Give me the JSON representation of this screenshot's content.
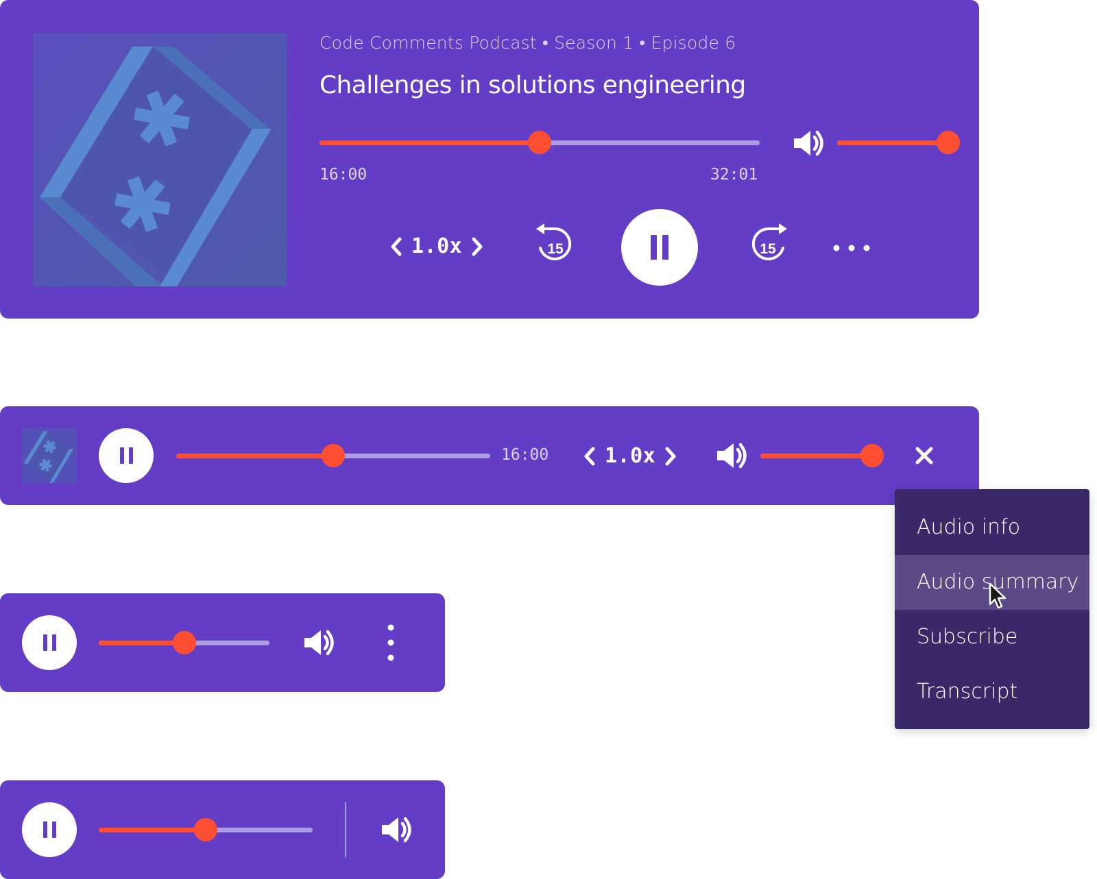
{
  "full_player": {
    "meta_line": "Code Comments Podcast • Season 1 • Episode 6",
    "title": "Challenges in solutions engineering",
    "progress_fraction": 0.5,
    "volume_fraction": 1.0,
    "elapsed": "16:00",
    "duration": "32:01",
    "speed": "1.0x",
    "rewind_seconds": "15",
    "forward_seconds": "15"
  },
  "compact_player": {
    "progress_fraction": 0.5,
    "volume_fraction": 1.0,
    "elapsed": "16:00",
    "speed": "1.0x"
  },
  "mini_player": {
    "progress_fraction": 0.5
  },
  "mini_player_2": {
    "progress_fraction": 0.5
  },
  "menu": {
    "items": [
      "Audio info",
      "Audio summary",
      "Subscribe",
      "Transcript"
    ],
    "hovered_index": 1
  },
  "colors": {
    "player_bg": "#633dc5",
    "accent": "#ff4f32",
    "track": "#a99de4",
    "menu_bg": "#3b2869",
    "menu_hover": "#5b4a86"
  },
  "icons": [
    "pause-icon",
    "volume-icon",
    "rewind-15-icon",
    "forward-15-icon",
    "more-horizontal-icon",
    "more-vertical-icon",
    "close-icon",
    "chevron-left-icon",
    "chevron-right-icon",
    "pointer-cursor-icon"
  ]
}
